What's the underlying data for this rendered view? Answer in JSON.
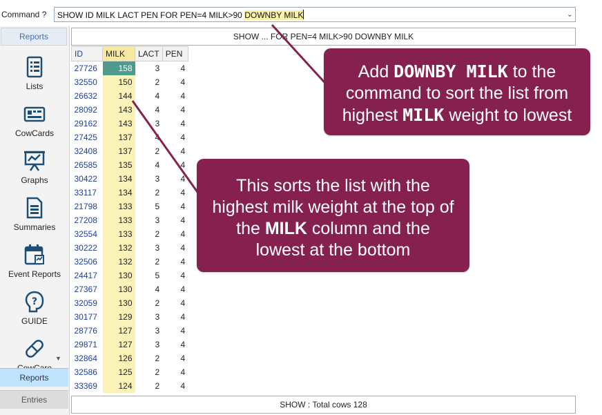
{
  "command": {
    "label": "Command ?",
    "text_main": "SHOW ID MILK LACT PEN FOR PEN=4 MILK>90 ",
    "text_highlight": "DOWNBY MILK"
  },
  "sidebar": {
    "header": "Reports",
    "items": [
      {
        "label": "Lists",
        "icon": "list-icon"
      },
      {
        "label": "CowCards",
        "icon": "cowcard-icon"
      },
      {
        "label": "Graphs",
        "icon": "graph-icon"
      },
      {
        "label": "Summaries",
        "icon": "summary-icon"
      },
      {
        "label": "Event Reports",
        "icon": "event-report-icon"
      },
      {
        "label": "GUIDE",
        "icon": "guide-icon"
      },
      {
        "label": "CowCare",
        "icon": "cowcare-icon"
      }
    ],
    "bottom_buttons": [
      "Reports",
      "Entries"
    ]
  },
  "report": {
    "title": "SHOW ...  FOR PEN=4 MILK>90 DOWNBY MILK",
    "columns": [
      "ID",
      "MILK",
      "LACT",
      "PEN"
    ],
    "rows": [
      [
        "27726",
        "158",
        "3",
        "4"
      ],
      [
        "32550",
        "150",
        "2",
        "4"
      ],
      [
        "26632",
        "144",
        "4",
        "4"
      ],
      [
        "28092",
        "143",
        "4",
        "4"
      ],
      [
        "29162",
        "143",
        "3",
        "4"
      ],
      [
        "27425",
        "137",
        "4",
        "4"
      ],
      [
        "32408",
        "137",
        "2",
        "4"
      ],
      [
        "26585",
        "135",
        "4",
        "4"
      ],
      [
        "30422",
        "134",
        "3",
        "4"
      ],
      [
        "33117",
        "134",
        "2",
        "4"
      ],
      [
        "21798",
        "133",
        "5",
        "4"
      ],
      [
        "27208",
        "133",
        "3",
        "4"
      ],
      [
        "32554",
        "133",
        "2",
        "4"
      ],
      [
        "30222",
        "132",
        "3",
        "4"
      ],
      [
        "32506",
        "132",
        "2",
        "4"
      ],
      [
        "24417",
        "130",
        "5",
        "4"
      ],
      [
        "27367",
        "130",
        "4",
        "4"
      ],
      [
        "32059",
        "130",
        "2",
        "4"
      ],
      [
        "30177",
        "129",
        "3",
        "4"
      ],
      [
        "28776",
        "127",
        "3",
        "4"
      ],
      [
        "29871",
        "127",
        "3",
        "4"
      ],
      [
        "32864",
        "126",
        "2",
        "4"
      ],
      [
        "32586",
        "125",
        "2",
        "4"
      ],
      [
        "33369",
        "124",
        "2",
        "4"
      ]
    ],
    "footer": "SHOW : Total cows  128"
  },
  "callouts": {
    "first": {
      "line1_a": "Add ",
      "line1_code": "DOWNBY MILK",
      "line1_b": " to the",
      "line2": "command to sort the list from",
      "line3_a": "highest ",
      "line3_code": "MILK",
      "line3_b": " weight to lowest"
    },
    "second": {
      "line1": "This sorts the list with the",
      "line2": "highest milk weight at the top of",
      "line3_a": "the ",
      "line3_bold": "MILK",
      "line3_b": " column and the",
      "line4": "lowest at the bottom"
    }
  },
  "colors": {
    "callout_bg": "#86214f",
    "highlight": "#fbf2a8",
    "selected_cell": "#4e9a8c",
    "accent": "#3b6fb6"
  }
}
